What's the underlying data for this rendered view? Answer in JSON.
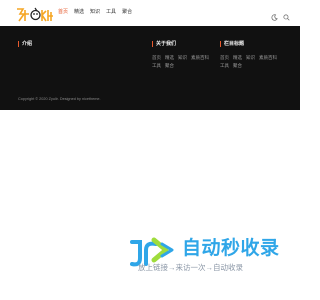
{
  "header": {
    "logo_text": "我的博客",
    "nav": [
      {
        "label": "首页",
        "active": true
      },
      {
        "label": "精选",
        "active": false
      },
      {
        "label": "知识",
        "active": false
      },
      {
        "label": "工具",
        "active": false
      },
      {
        "label": "聚合",
        "active": false
      }
    ],
    "icons": [
      "moon-icon",
      "search-icon"
    ]
  },
  "footer": {
    "intro": {
      "title": "介绍"
    },
    "about": {
      "title": "关于我们",
      "links": [
        "首页",
        "精选",
        "知识",
        "素质百科",
        "工具",
        "聚合"
      ]
    },
    "columns": {
      "title": "栏目标题",
      "links": [
        "首页",
        "精选",
        "知识",
        "素质百科",
        "工具",
        "聚合"
      ]
    },
    "copyright": "Copyright © 2020 Zyulir. Designed by nicetheme."
  },
  "watermark": {
    "title": "自动秒收录",
    "subtitle": "放上链接→来访一次→自动收录",
    "accent": "#2fa6e8",
    "accent_light": "#9fdc3c"
  },
  "colors": {
    "accent": "#e65a2e",
    "footer_bg": "#111111"
  }
}
